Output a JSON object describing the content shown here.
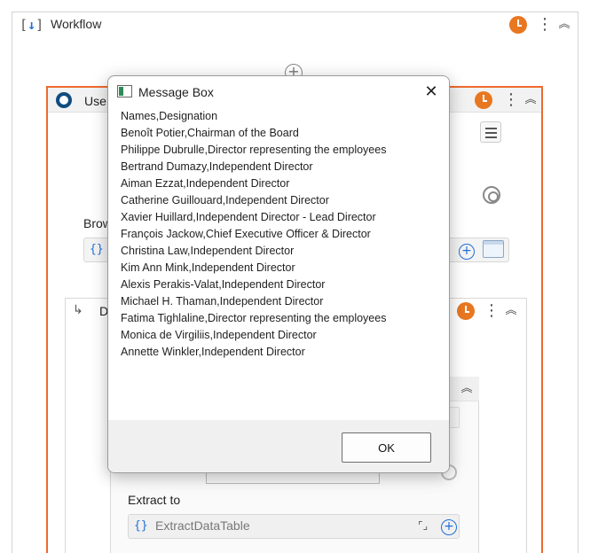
{
  "workflow": {
    "title": "Workflow",
    "icon": "bracket-download-icon"
  },
  "use_application": {
    "title": "Use",
    "browser_label": "Brow",
    "browser_field_icon": "{}"
  },
  "do_container": {
    "title": "D"
  },
  "extract": {
    "label": "Extract to",
    "field_icon": "{}",
    "value": "ExtractDataTable"
  },
  "message_box": {
    "title": "Message Box",
    "close_glyph": "✕",
    "lines": [
      "Names,Designation",
      "Benoît Potier,Chairman of the Board",
      "Philippe Dubrulle,Director representing the employees",
      "Bertrand Dumazy,Independent Director",
      "Aiman Ezzat,Independent Director",
      "Catherine Guillouard,Independent Director",
      "Xavier Huillard,Independent Director - Lead Director",
      "François Jackow,Chief Executive Officer & Director",
      "Christina Law,Independent Director",
      "Kim Ann Mink,Independent Director",
      "Alexis Perakis-Valat,Independent Director",
      "Michael H. Thaman,Independent Director",
      "Fatima Tighlaline,Director representing the employees",
      "Monica de Virgiliis,Independent Director",
      "Annette Winkler,Independent Director"
    ],
    "ok_label": "OK"
  },
  "colors": {
    "accent_orange": "#ee6a2e",
    "clock_orange": "#e87722",
    "link_blue": "#1f6fd8"
  }
}
